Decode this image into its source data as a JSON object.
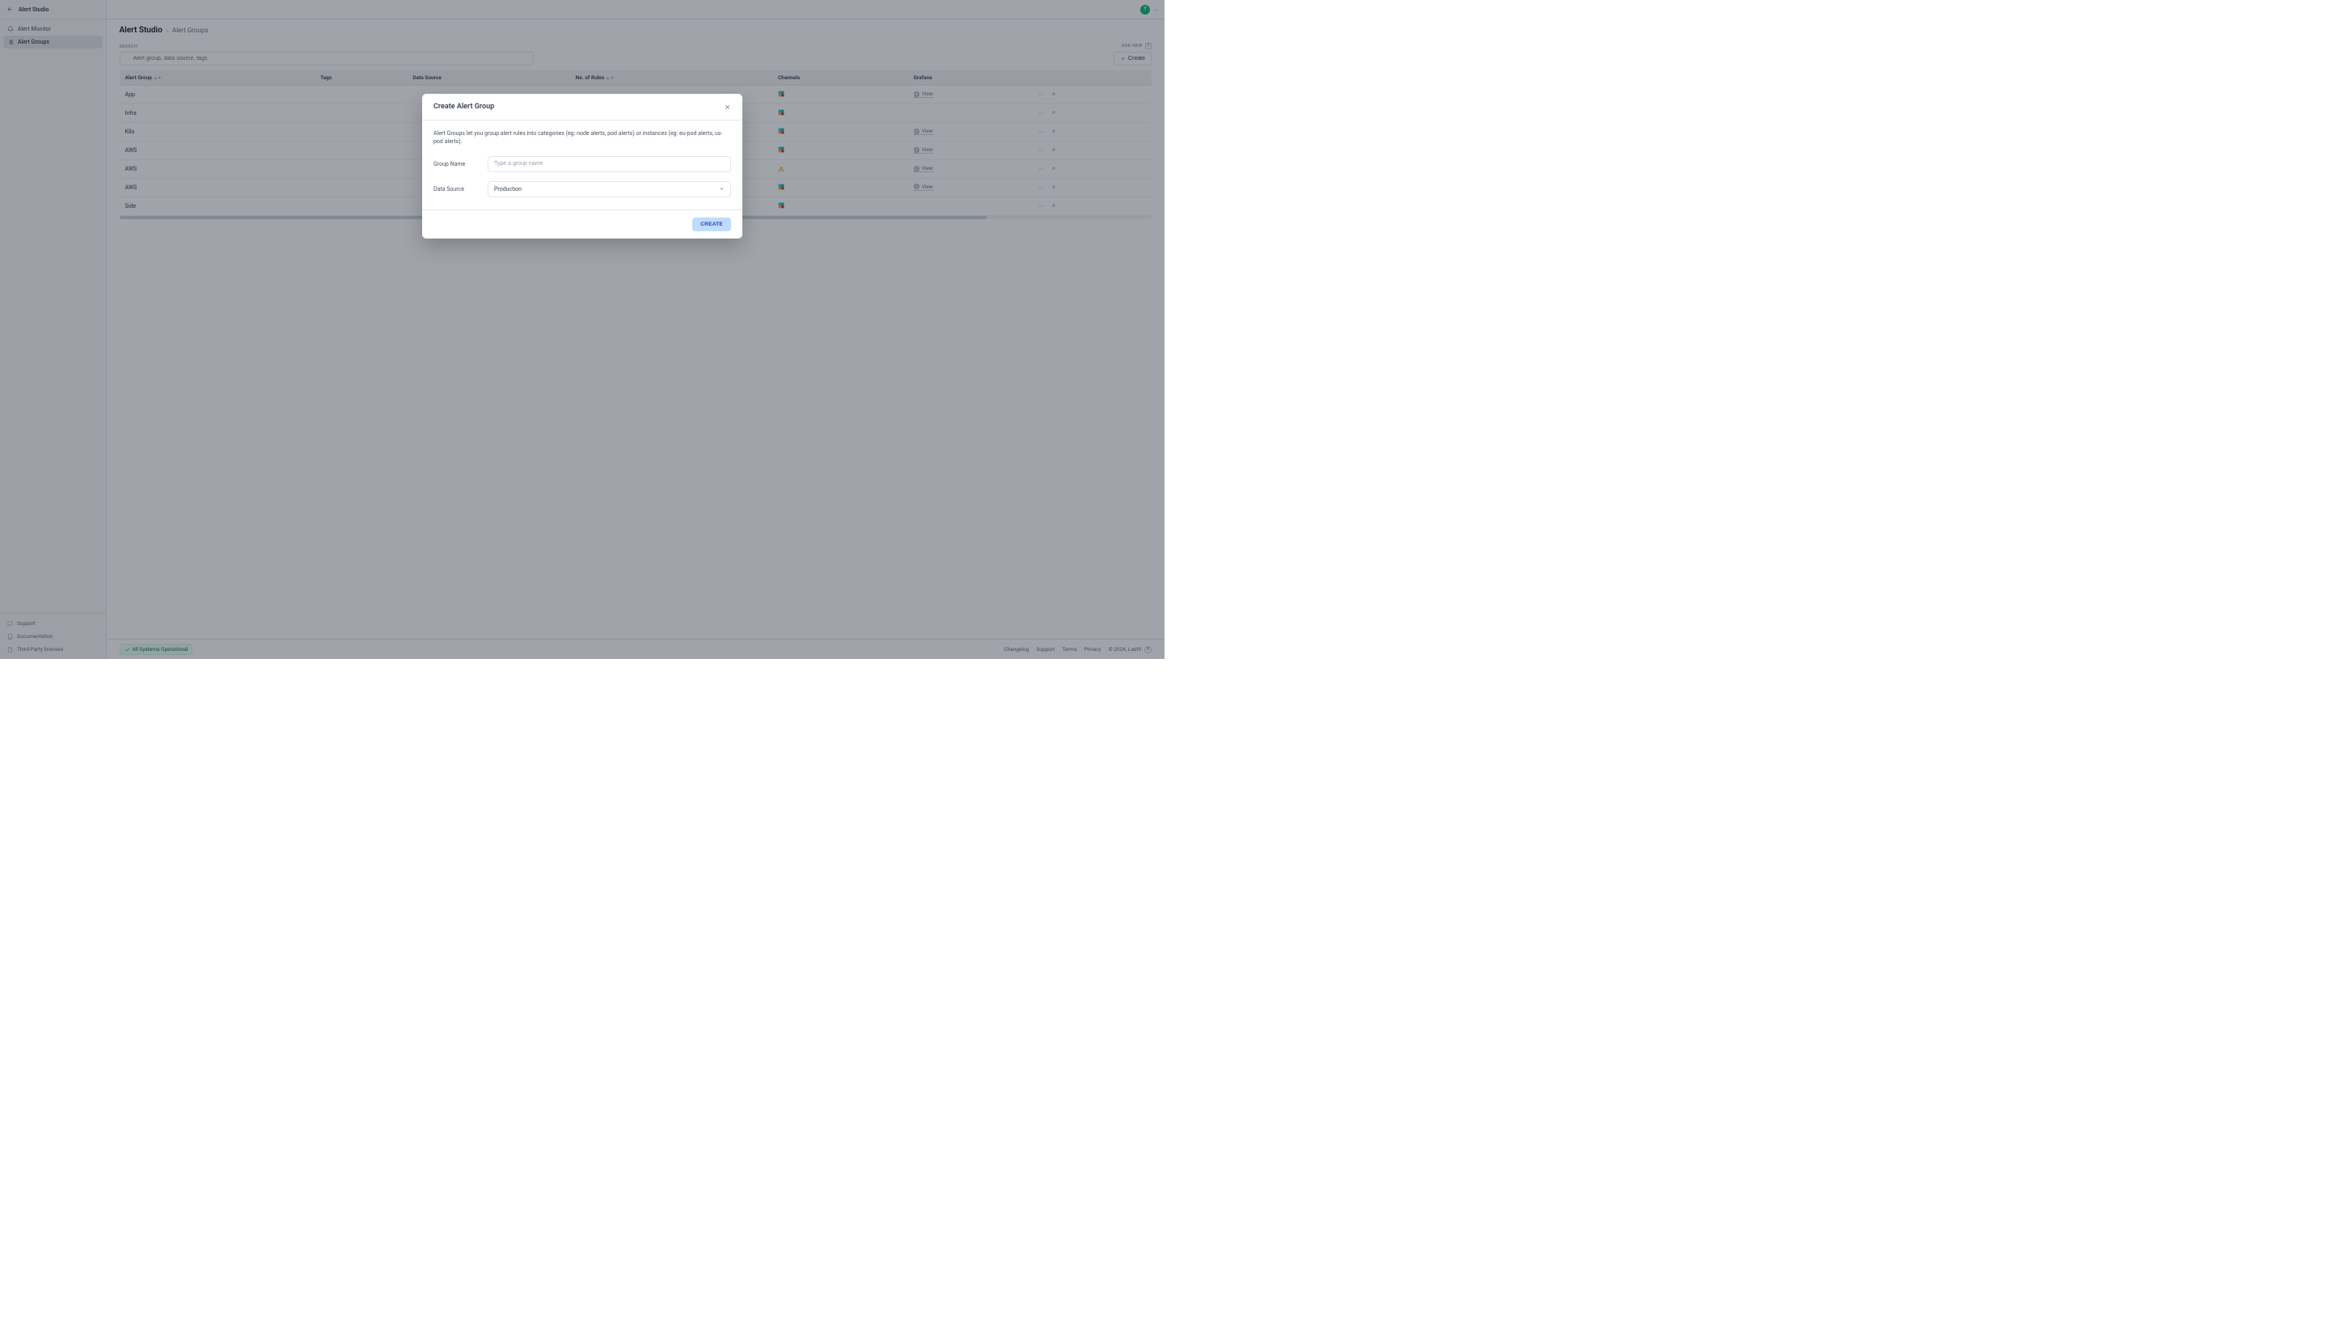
{
  "app_name": "Alert Studio",
  "sidebar": {
    "items": [
      {
        "label": "Alert Monitor",
        "active": false
      },
      {
        "label": "Alert Groups",
        "active": true
      }
    ],
    "footer": [
      {
        "label": "Support"
      },
      {
        "label": "Documentation"
      },
      {
        "label": "Third-Party licenses"
      }
    ]
  },
  "avatar_initial": "T",
  "breadcrumbs": {
    "root": "Alert Studio",
    "current": "Alert Groups"
  },
  "search": {
    "label": "SEARCH",
    "placeholder": "Alert group, data source, tags"
  },
  "add_new": {
    "label": "ADD NEW",
    "shortcut": "?",
    "button": "Create"
  },
  "table": {
    "columns": [
      "Alert Group",
      "Tags",
      "Data Source",
      "No. of Rules",
      "Channels",
      "Grafana",
      ""
    ],
    "rows": [
      {
        "name": "App",
        "channel": "slack",
        "grafana": true
      },
      {
        "name": "Infra",
        "channel": "slack",
        "grafana": false
      },
      {
        "name": "K8s",
        "channel": "slack",
        "grafana": true
      },
      {
        "name": "AWS",
        "channel": "slack",
        "grafana": true
      },
      {
        "name": "AWS",
        "channel": "warn",
        "grafana": true
      },
      {
        "name": "AWS",
        "channel": "slack",
        "grafana": true
      },
      {
        "name": "Side",
        "channel": "slack",
        "grafana": false
      }
    ],
    "view_label": "View"
  },
  "footer": {
    "status": "All Systems Operational",
    "links": [
      "Changelog",
      "Support",
      "Terms",
      "Privacy"
    ],
    "copyright": "© 2024, Last9",
    "badge": "9"
  },
  "modal": {
    "title": "Create Alert Group",
    "description": "Alert Groups let you group alert rules into categories (eg: node alerts, pod alerts) or instances (eg: eu-pod alerts, us-pod alerts).",
    "group_name_label": "Group Name",
    "group_name_placeholder": "Type a group name",
    "data_source_label": "Data Source",
    "data_source_value": "Production",
    "submit": "CREATE"
  }
}
